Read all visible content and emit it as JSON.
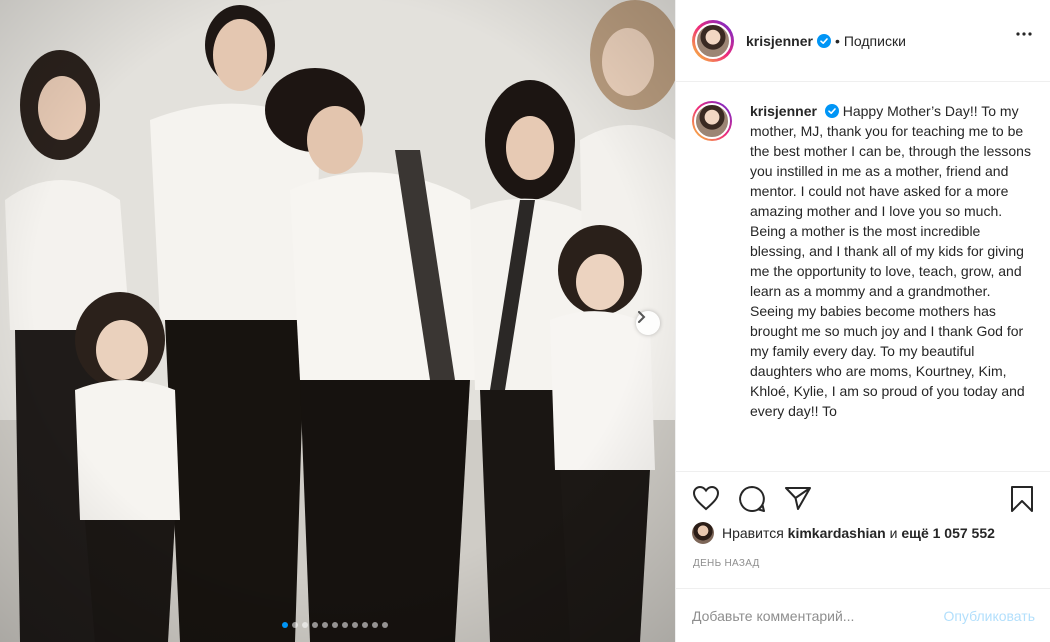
{
  "photo": {
    "alt_icon": "next-arrow-icon",
    "dots_total": 11,
    "dot_active_index": 0
  },
  "header": {
    "username": "krisjenner",
    "separator": "•",
    "follow_label": "Подписки"
  },
  "caption": {
    "username": "krisjenner",
    "text": "Happy Mother’s Day!! To my mother, MJ, thank you for teaching me to be the best mother I can be, through the lessons you instilled in me as a mother, friend and mentor. I could not have asked for a more amazing mother and I love you so much. Being a mother is the most incredible blessing, and I thank all of my kids for giving me the opportunity to love, teach, grow, and learn as a mommy and a grandmother. Seeing my babies become mothers has brought me so much joy and I thank God for my family every day. To my beautiful daughters who are moms, Kourtney, Kim, Khloé, Kylie, I am so proud of you today and every day!! To"
  },
  "likes": {
    "prefix": "Нравится",
    "user": "kimkardashian",
    "middle": "и",
    "rest": "ещё 1 057 552"
  },
  "time_label": "ДЕНЬ НАЗАД",
  "comment": {
    "placeholder": "Добавьте комментарий...",
    "publish_label": "Опубликовать"
  },
  "colors": {
    "accent": "#0095f6",
    "publish_disabled": "#b2dffc",
    "muted": "#8e8e8e"
  }
}
